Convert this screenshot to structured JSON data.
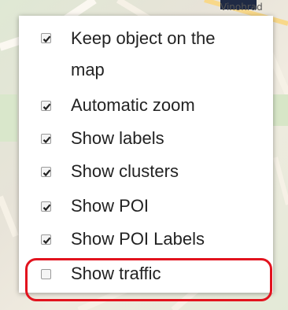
{
  "map": {
    "labels": [
      "Vinohrad"
    ]
  },
  "menu": {
    "items": [
      {
        "label_line1": "Keep object on the",
        "label_line2": "map",
        "checked": true
      },
      {
        "label": "Automatic zoom",
        "checked": true
      },
      {
        "label": "Show labels",
        "checked": true
      },
      {
        "label": "Show clusters",
        "checked": true
      },
      {
        "label": "Show POI",
        "checked": true
      },
      {
        "label": "Show POI Labels",
        "checked": true
      },
      {
        "label": "Show traffic",
        "checked": false
      }
    ]
  },
  "colors": {
    "highlight": "#e2131e",
    "checkmark": "#222222"
  }
}
